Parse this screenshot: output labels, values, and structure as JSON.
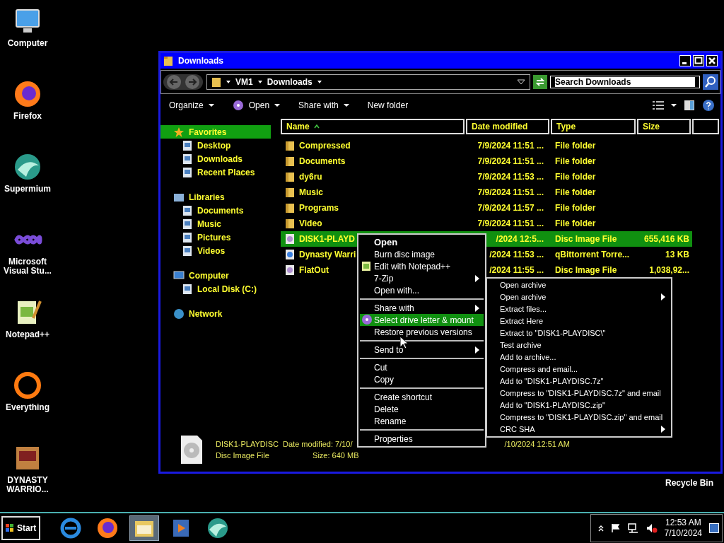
{
  "desktop_icons": [
    {
      "label": "Computer"
    },
    {
      "label": "Firefox"
    },
    {
      "label": "Supermium"
    },
    {
      "label": "Microsoft Visual Stu..."
    },
    {
      "label": "Notepad++"
    },
    {
      "label": "Everything"
    },
    {
      "label": "DYNASTY WARRIO..."
    }
  ],
  "recycle_bin": {
    "label": "Recycle Bin"
  },
  "window": {
    "title": "Downloads",
    "address": [
      "VM1",
      "Downloads"
    ],
    "search": {
      "placeholder": "Search Downloads"
    },
    "toolbar": [
      {
        "label": "Organize",
        "dropdown": true
      },
      {
        "label": "Open",
        "dropdown": true
      },
      {
        "label": "Share with",
        "dropdown": true
      },
      {
        "label": "New folder",
        "dropdown": false
      }
    ],
    "nav": [
      {
        "label": "Favorites",
        "selected": true,
        "children": [
          {
            "label": "Desktop",
            "selected": false
          },
          {
            "label": "Downloads",
            "selected": false
          },
          {
            "label": "Recent Places",
            "selected": false
          }
        ]
      },
      {
        "label": "Libraries",
        "selected": false,
        "children": [
          {
            "label": "Documents",
            "selected": false
          },
          {
            "label": "Music",
            "selected": false
          },
          {
            "label": "Pictures",
            "selected": false
          },
          {
            "label": "Videos",
            "selected": false
          }
        ]
      },
      {
        "label": "Computer",
        "selected": false,
        "children": [
          {
            "label": "Local Disk (C:)",
            "selected": false
          }
        ]
      },
      {
        "label": "Network",
        "selected": false
      }
    ],
    "columns": [
      "Name",
      "Date modified",
      "Type",
      "Size"
    ],
    "rows": [
      {
        "kind": "folder",
        "name": "Compressed",
        "date": "7/9/2024 11:51 ...",
        "type": "File folder",
        "size": "",
        "selected": false
      },
      {
        "kind": "folder",
        "name": "Documents",
        "date": "7/9/2024 11:51 ...",
        "type": "File folder",
        "size": "",
        "selected": false
      },
      {
        "kind": "folder",
        "name": "dy6ru",
        "date": "7/9/2024 11:53 ...",
        "type": "File folder",
        "size": "",
        "selected": false
      },
      {
        "kind": "folder",
        "name": "Music",
        "date": "7/9/2024 11:51 ...",
        "type": "File folder",
        "size": "",
        "selected": false
      },
      {
        "kind": "folder",
        "name": "Programs",
        "date": "7/9/2024 11:57 ...",
        "type": "File folder",
        "size": "",
        "selected": false
      },
      {
        "kind": "folder",
        "name": "Video",
        "date": "7/9/2024 11:51 ...",
        "type": "File folder",
        "size": "",
        "selected": false
      },
      {
        "kind": "disc",
        "name": "DISK1-PLAYD",
        "date": "/2024 12:5...",
        "type": "Disc Image File",
        "size": "655,416 KB",
        "selected": true
      },
      {
        "kind": "torrent",
        "name": "Dynasty Warri",
        "date": "/2024 11:53 ...",
        "type": "qBittorrent Torre...",
        "size": "13 KB",
        "selected": false
      },
      {
        "kind": "disc",
        "name": "FlatOut",
        "date": "/2024 11:55 ...",
        "type": "Disc Image File",
        "size": "1,038,92...",
        "selected": false
      }
    ],
    "details": {
      "name": "DISK1-PLAYDISC",
      "modified": "Date modified: 7/10/",
      "modified_rest": "/10/2024 12:51 AM",
      "type": "Disc Image File",
      "size": "Size: 640 MB"
    }
  },
  "context_menu": [
    {
      "kind": "item",
      "label": "Open",
      "default": true,
      "submenu": false,
      "selected": false
    },
    {
      "kind": "item",
      "label": "Burn disc image",
      "default": false,
      "submenu": false,
      "selected": false
    },
    {
      "kind": "item",
      "label": "Edit with Notepad++",
      "default": false,
      "submenu": false,
      "selected": false
    },
    {
      "kind": "item",
      "label": "7-Zip",
      "default": false,
      "submenu": true,
      "selected": false
    },
    {
      "kind": "item",
      "label": "Open with...",
      "default": false,
      "submenu": false,
      "selected": false
    },
    {
      "kind": "separator"
    },
    {
      "kind": "item",
      "label": "Share with",
      "default": false,
      "submenu": true,
      "selected": false
    },
    {
      "kind": "item",
      "label": "Select drive letter & mount",
      "default": false,
      "submenu": false,
      "selected": true
    },
    {
      "kind": "item",
      "label": "Restore previous versions",
      "default": false,
      "submenu": false,
      "selected": false
    },
    {
      "kind": "separator"
    },
    {
      "kind": "item",
      "label": "Send to",
      "default": false,
      "submenu": true,
      "selected": false
    },
    {
      "kind": "separator"
    },
    {
      "kind": "item",
      "label": "Cut",
      "default": false,
      "submenu": false,
      "selected": false
    },
    {
      "kind": "item",
      "label": "Copy",
      "default": false,
      "submenu": false,
      "selected": false
    },
    {
      "kind": "separator"
    },
    {
      "kind": "item",
      "label": "Create shortcut",
      "default": false,
      "submenu": false,
      "selected": false
    },
    {
      "kind": "item",
      "label": "Delete",
      "default": false,
      "submenu": false,
      "selected": false
    },
    {
      "kind": "item",
      "label": "Rename",
      "default": false,
      "submenu": false,
      "selected": false
    },
    {
      "kind": "separator"
    },
    {
      "kind": "item",
      "label": "Properties",
      "default": false,
      "submenu": false,
      "selected": false
    }
  ],
  "submenu": [
    {
      "label": "Open archive",
      "submenu": false
    },
    {
      "label": "Open archive",
      "submenu": true
    },
    {
      "label": "Extract files...",
      "submenu": false
    },
    {
      "label": "Extract Here",
      "submenu": false
    },
    {
      "label": "Extract to \"DISK1-PLAYDISC\\\"",
      "submenu": false
    },
    {
      "label": "Test archive",
      "submenu": false
    },
    {
      "label": "Add to archive...",
      "submenu": false
    },
    {
      "label": "Compress and email...",
      "submenu": false
    },
    {
      "label": "Add to \"DISK1-PLAYDISC.7z\"",
      "submenu": false
    },
    {
      "label": "Compress to \"DISK1-PLAYDISC.7z\" and email",
      "submenu": false
    },
    {
      "label": "Add to \"DISK1-PLAYDISC.zip\"",
      "submenu": false
    },
    {
      "label": "Compress to \"DISK1-PLAYDISC.zip\" and email",
      "submenu": false
    },
    {
      "label": "CRC SHA",
      "submenu": true
    }
  ],
  "taskbar": {
    "start": "Start",
    "apps": [
      {
        "selected": false
      },
      {
        "selected": false
      },
      {
        "selected": true
      },
      {
        "selected": false
      },
      {
        "selected": false
      }
    ],
    "time": "12:53 AM",
    "date": "7/10/2024"
  }
}
